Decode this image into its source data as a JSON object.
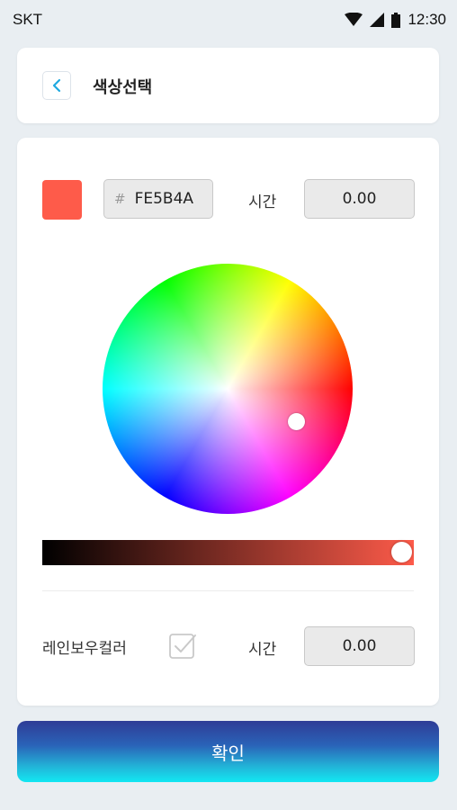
{
  "status_bar": {
    "carrier": "SKT",
    "time": "12:30",
    "icons": [
      "wifi-icon",
      "cell-signal-icon",
      "battery-icon"
    ]
  },
  "header": {
    "back_icon": "chevron-left-icon",
    "title": "색상선택"
  },
  "color": {
    "swatch_color": "#FE5B4A",
    "hex_prefix": "#",
    "hex_value": "FE5B4A",
    "time_label": "시간",
    "time_value": "0.00"
  },
  "brightness_slider": {
    "start_color": "#000000",
    "end_color": "#FE5B4A",
    "level": 1.0
  },
  "rainbow": {
    "label": "레인보우컬러",
    "checked": false,
    "time_label": "시간",
    "time_value": "0.00"
  },
  "confirm_button": {
    "label": "확인"
  },
  "colors": {
    "accent": "#1fa9e0",
    "button_top": "#2f3c96",
    "button_bottom": "#12e7f2"
  }
}
